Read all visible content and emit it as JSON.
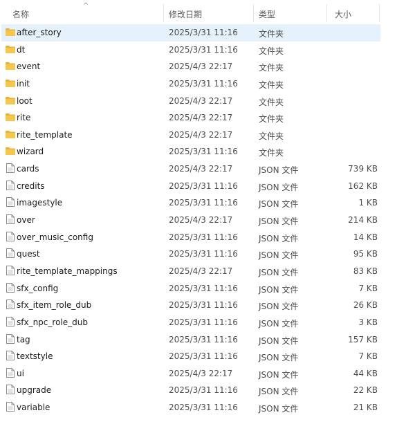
{
  "header": {
    "name": "名称",
    "modified": "修改日期",
    "type": "类型",
    "size": "大小",
    "sort_indicator": "^"
  },
  "colors": {
    "selected_row": "#e5f1fb",
    "folder": "#e8b23a"
  },
  "rows": [
    {
      "name": "after_story",
      "date": "2025/3/31 11:16",
      "type": "文件夹",
      "size": "",
      "icon": "folder-icon",
      "selected": true
    },
    {
      "name": "dt",
      "date": "2025/3/31 11:16",
      "type": "文件夹",
      "size": "",
      "icon": "folder-icon"
    },
    {
      "name": "event",
      "date": "2025/4/3 22:17",
      "type": "文件夹",
      "size": "",
      "icon": "folder-icon"
    },
    {
      "name": "init",
      "date": "2025/3/31 11:16",
      "type": "文件夹",
      "size": "",
      "icon": "folder-icon"
    },
    {
      "name": "loot",
      "date": "2025/4/3 22:17",
      "type": "文件夹",
      "size": "",
      "icon": "folder-icon"
    },
    {
      "name": "rite",
      "date": "2025/4/3 22:17",
      "type": "文件夹",
      "size": "",
      "icon": "folder-icon"
    },
    {
      "name": "rite_template",
      "date": "2025/4/3 22:17",
      "type": "文件夹",
      "size": "",
      "icon": "folder-icon"
    },
    {
      "name": "wizard",
      "date": "2025/3/31 11:16",
      "type": "文件夹",
      "size": "",
      "icon": "folder-icon"
    },
    {
      "name": "cards",
      "date": "2025/4/3 22:17",
      "type": "JSON 文件",
      "size": "739 KB",
      "icon": "file-icon"
    },
    {
      "name": "credits",
      "date": "2025/3/31 11:16",
      "type": "JSON 文件",
      "size": "162 KB",
      "icon": "file-icon"
    },
    {
      "name": "imagestyle",
      "date": "2025/3/31 11:16",
      "type": "JSON 文件",
      "size": "1 KB",
      "icon": "file-icon"
    },
    {
      "name": "over",
      "date": "2025/4/3 22:17",
      "type": "JSON 文件",
      "size": "214 KB",
      "icon": "file-icon"
    },
    {
      "name": "over_music_config",
      "date": "2025/3/31 11:16",
      "type": "JSON 文件",
      "size": "14 KB",
      "icon": "file-icon"
    },
    {
      "name": "quest",
      "date": "2025/3/31 11:16",
      "type": "JSON 文件",
      "size": "95 KB",
      "icon": "file-icon"
    },
    {
      "name": "rite_template_mappings",
      "date": "2025/4/3 22:17",
      "type": "JSON 文件",
      "size": "83 KB",
      "icon": "file-icon"
    },
    {
      "name": "sfx_config",
      "date": "2025/3/31 11:16",
      "type": "JSON 文件",
      "size": "7 KB",
      "icon": "file-icon"
    },
    {
      "name": "sfx_item_role_dub",
      "date": "2025/3/31 11:16",
      "type": "JSON 文件",
      "size": "26 KB",
      "icon": "file-icon"
    },
    {
      "name": "sfx_npc_role_dub",
      "date": "2025/3/31 11:16",
      "type": "JSON 文件",
      "size": "3 KB",
      "icon": "file-icon"
    },
    {
      "name": "tag",
      "date": "2025/3/31 11:16",
      "type": "JSON 文件",
      "size": "157 KB",
      "icon": "file-icon"
    },
    {
      "name": "textstyle",
      "date": "2025/3/31 11:16",
      "type": "JSON 文件",
      "size": "7 KB",
      "icon": "file-icon"
    },
    {
      "name": "ui",
      "date": "2025/4/3 22:17",
      "type": "JSON 文件",
      "size": "44 KB",
      "icon": "file-icon"
    },
    {
      "name": "upgrade",
      "date": "2025/3/31 11:16",
      "type": "JSON 文件",
      "size": "22 KB",
      "icon": "file-icon"
    },
    {
      "name": "variable",
      "date": "2025/3/31 11:16",
      "type": "JSON 文件",
      "size": "21 KB",
      "icon": "file-icon"
    }
  ]
}
